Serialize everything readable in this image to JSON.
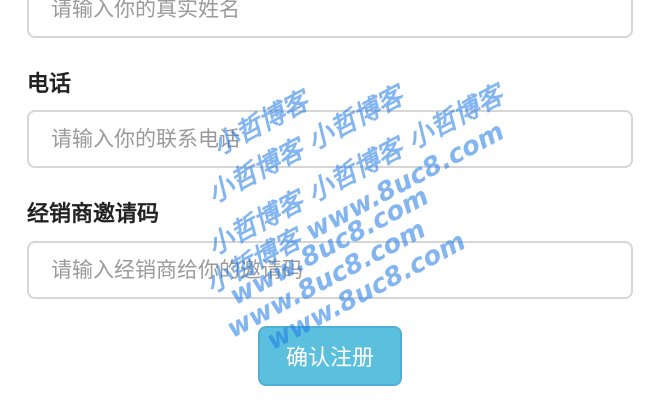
{
  "form": {
    "name_placeholder": "请输入你的真实姓名",
    "phone_label": "电话",
    "phone_placeholder": "请输入你的联系电话",
    "invite_label": "经销商邀请码",
    "invite_placeholder": "请输入经销商给你的邀请码",
    "submit_label": "确认注册"
  },
  "watermark": {
    "lines": [
      "小哲博客",
      "小哲博客 小哲博客",
      "小哲博客 小哲博客 小哲博客",
      "小哲博客 www.8uc8.com",
      "www.8uc8.com",
      "www.8uc8.com",
      "www.8uc8.com"
    ],
    "color": "#1e78e6"
  }
}
